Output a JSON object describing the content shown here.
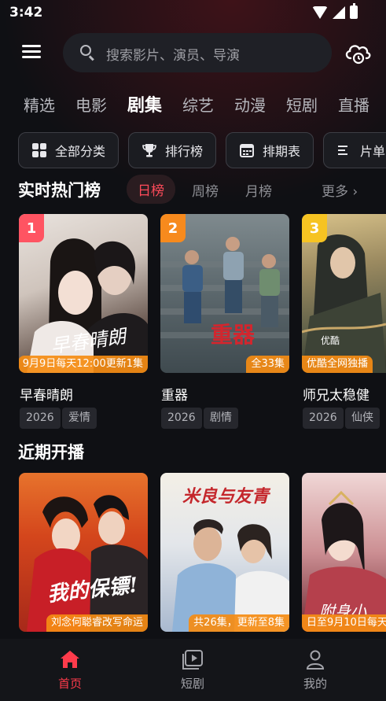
{
  "status_bar": {
    "time": "3:42"
  },
  "search": {
    "placeholder": "搜索影片、演员、导演"
  },
  "tabs": [
    "精选",
    "电影",
    "剧集",
    "综艺",
    "动漫",
    "短剧",
    "直播"
  ],
  "active_tab": "剧集",
  "chips": [
    "全部分类",
    "排行榜",
    "排期表",
    "片单"
  ],
  "hot_section": {
    "title": "实时热门榜",
    "rank_tabs": [
      "日榜",
      "周榜",
      "月榜"
    ],
    "more": "更多 ›",
    "items": [
      {
        "rank": "1",
        "title": "早春晴朗",
        "episode_label": "9月9日每天12:00更新1集",
        "year": "2026",
        "genre": "爱情",
        "art_text": "早春晴朗"
      },
      {
        "rank": "2",
        "title": "重器",
        "episode_label": "全33集",
        "year": "2026",
        "genre": "剧情",
        "art_text": "重器"
      },
      {
        "rank": "3",
        "title": "师兄太稳健",
        "episode_label": "优酷全网独播",
        "year": "2026",
        "genre": "仙侠",
        "art_text": "优酷"
      }
    ]
  },
  "upcoming_section": {
    "title": "近期开播",
    "items": [
      {
        "episode_label": "刘念何聪睿改写命运",
        "art_text": "我的保镖!"
      },
      {
        "episode_label": "共26集，更新至8集",
        "art_text": "米良与友青"
      },
      {
        "episode_label": "日至9月10日每天",
        "art_text": "附身小"
      }
    ]
  },
  "bottom_nav": [
    {
      "label": "首页",
      "icon": "home-icon",
      "active": true
    },
    {
      "label": "短剧",
      "icon": "play-square-icon",
      "active": false
    },
    {
      "label": "我的",
      "icon": "user-icon",
      "active": false
    }
  ],
  "colors": {
    "accent": "#ff3b4b",
    "rank1": "#ff5462",
    "rank2": "#f78a1d",
    "rank3": "#f6c322",
    "episode": "#f58c14"
  }
}
